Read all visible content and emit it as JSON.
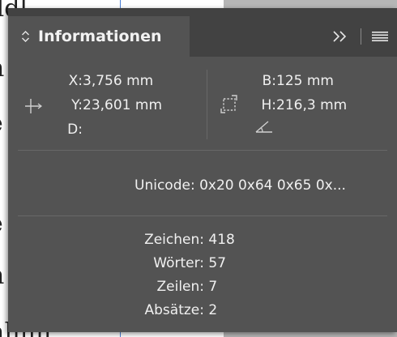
{
  "panel": {
    "title": "Informationen",
    "position": {
      "x_label": "X:",
      "x_value": "3,756 mm",
      "y_label": "Y:",
      "y_value": "23,601 mm",
      "d_label": "D:",
      "d_value": ""
    },
    "size": {
      "w_label": "B:",
      "w_value": "125 mm",
      "h_label": "H:",
      "h_value": "216,3 mm"
    },
    "unicode": {
      "label": "Unicode:",
      "value": "0x20 0x64 0x65 0x..."
    },
    "stats": [
      {
        "label": "Zeichen:",
        "value": "418"
      },
      {
        "label": "Wörter:",
        "value": "57"
      },
      {
        "label": "Zeilen:",
        "value": "7"
      },
      {
        "label": "Absätze:",
        "value": "2"
      }
    ]
  },
  "icons": {
    "collapse": "up-down-chevron-icon",
    "more": "double-chevron-right-icon",
    "menu": "hamburger-menu-icon",
    "position": "crosshair-position-icon",
    "size": "bounding-box-icon",
    "angle": "angle-icon"
  },
  "colors": {
    "panel_bg": "#535353",
    "titlebar_bg": "#424242",
    "text": "#f0f0f0"
  }
}
